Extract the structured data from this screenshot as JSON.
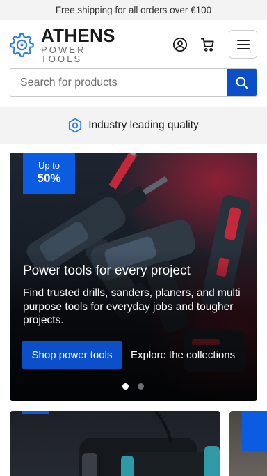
{
  "announcement": {
    "text": "Free shipping for all orders over €100"
  },
  "brand": {
    "name": "ATHENS",
    "tagline": "POWER TOOLS"
  },
  "header": {
    "account_icon": "user-circle-icon",
    "cart_icon": "shopping-cart-icon",
    "menu_icon": "hamburger-menu-icon"
  },
  "search": {
    "placeholder": "Search for products",
    "value": "",
    "icon": "search-icon"
  },
  "usp": {
    "text": "Industry leading quality",
    "icon": "hexagon-icon"
  },
  "hero": {
    "badge_top": "Up to",
    "badge_value": "50%",
    "title": "Power tools for every project",
    "description": "Find trusted drills, sanders, planers, and multi purpose tools for everyday jobs and tougher projects.",
    "cta_label": "Shop power tools",
    "secondary_link": "Explore the collections",
    "slide_count": 2,
    "active_slide": 1
  },
  "colors": {
    "accent": "#0b4fc9",
    "badge": "#0b5ce0",
    "logo": "#2f7fe0",
    "announcement_bg": "#f3f3f3"
  }
}
